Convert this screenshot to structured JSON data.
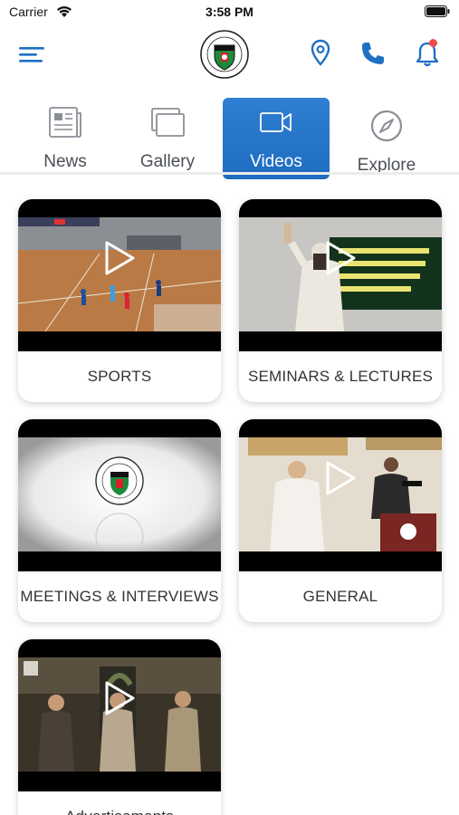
{
  "status_bar": {
    "carrier": "Carrier",
    "time": "3:58 PM"
  },
  "header": {
    "icons": [
      "hamburger-menu-icon",
      "club-logo",
      "location-pin-icon",
      "phone-icon",
      "bell-icon"
    ],
    "accent_color": "#1f6fc5",
    "notification_dot_color": "#ef4b4b"
  },
  "tabs": [
    {
      "label": "News",
      "icon": "newspaper-icon",
      "active": false
    },
    {
      "label": "Gallery",
      "icon": "gallery-icon",
      "active": false
    },
    {
      "label": "Videos",
      "icon": "video-camera-icon",
      "active": true
    },
    {
      "label": "Explore",
      "icon": "compass-icon",
      "active": false
    }
  ],
  "videos": [
    {
      "label": "SPORTS"
    },
    {
      "label": "SEMINARS & LECTURES"
    },
    {
      "label": "MEETINGS & INTERVIEWS"
    },
    {
      "label": "GENERAL"
    },
    {
      "label": "Advertisements"
    }
  ]
}
